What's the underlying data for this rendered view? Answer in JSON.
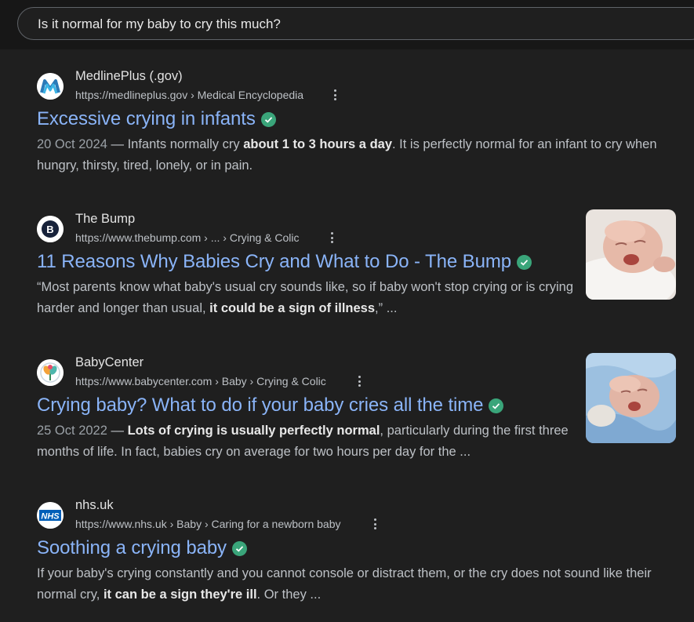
{
  "search": {
    "query": "Is it normal for my baby to cry this much?"
  },
  "results": [
    {
      "site": "MedlinePlus (.gov)",
      "url": "https://medlineplus.gov › Medical Encyclopedia",
      "title": "Excessive crying in infants",
      "date": "20 Oct 2024",
      "sep": " — ",
      "s1": "Infants normally cry ",
      "b1": "about 1 to 3 hours a day",
      "s2": ". It is perfectly normal for an infant to cry when hungry, thirsty, tired, lonely, or in pain.",
      "icon": "medlineplus-logo-icon"
    },
    {
      "site": "The Bump",
      "url": "https://www.thebump.com › ... › Crying & Colic",
      "title": "11 Reasons Why Babies Cry and What to Do - The Bump",
      "s1": "“Most parents know what baby's usual cry sounds like, so if baby won't stop crying or is crying harder and longer than usual, ",
      "b1": "it could be a sign of illness",
      "s2": ",” ...",
      "icon": "thebump-logo-icon",
      "thumbnail": "crying-newborn-photo"
    },
    {
      "site": "BabyCenter",
      "url": "https://www.babycenter.com › Baby › Crying & Colic",
      "title": "Crying baby? What to do if your baby cries all the time",
      "date": "25 Oct 2022",
      "sep": " — ",
      "b1": "Lots of crying is usually perfectly normal",
      "s2": ", particularly during the first three months of life. In fact, babies cry on average for two hours per day for the ...",
      "icon": "babycenter-logo-icon",
      "thumbnail": "crying-baby-on-blue-blanket-photo"
    },
    {
      "site": "nhs.uk",
      "url": "https://www.nhs.uk › Baby › Caring for a newborn baby",
      "title": "Soothing a crying baby",
      "s1": "If your baby's crying constantly and you cannot console or distract them, or the cry does not sound like their normal cry, ",
      "b1": "it can be a sign they're ill",
      "s2": ". Or they ...",
      "icon": "nhs-logo-icon",
      "logo_text": "NHS"
    }
  ],
  "colors": {
    "background": "#1f1f1f",
    "link": "#8ab4f8",
    "verified": "#3aa57a",
    "text": "#bdc1c6"
  }
}
